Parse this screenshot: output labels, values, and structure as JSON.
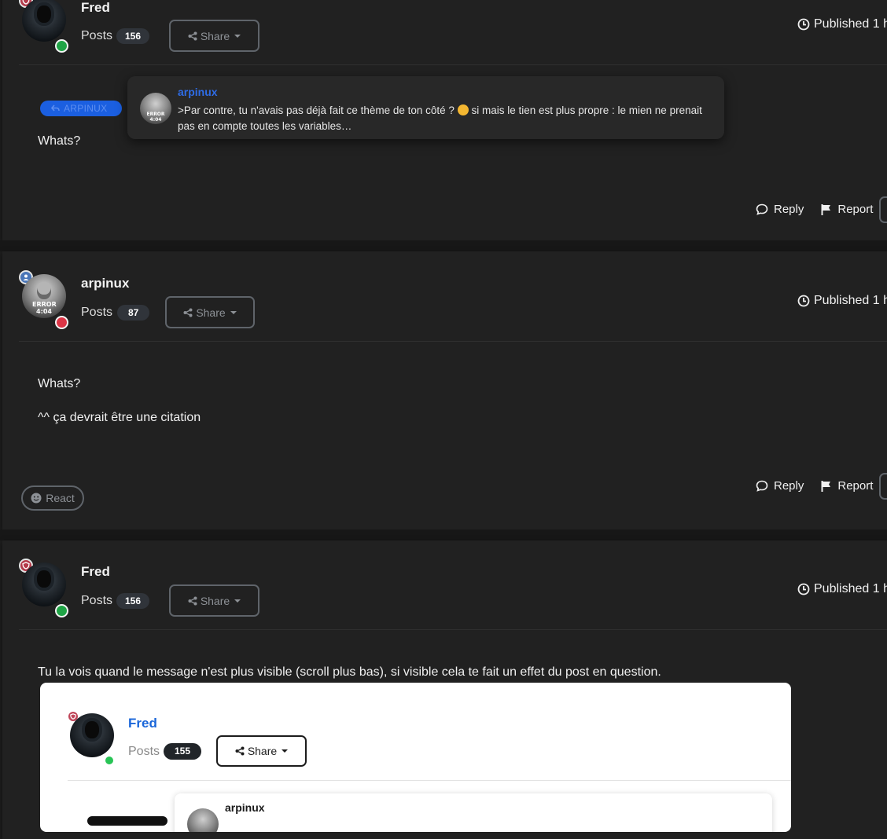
{
  "posts": [
    {
      "author": "Fred",
      "posts_label": "Posts",
      "post_count": "156",
      "share_label": "Share",
      "published": "Published 1 h",
      "quote_tag": "ARPINUX",
      "body_lines": [
        "Whats?"
      ],
      "reply_label": "Reply",
      "report_label": "Report"
    },
    {
      "author": "arpinux",
      "posts_label": "Posts",
      "post_count": "87",
      "share_label": "Share",
      "published": "Published 1 h",
      "avatar_text": "ERROR 4:04",
      "body_lines": [
        "Whats?",
        "^^ ça devrait être une citation"
      ],
      "react_label": "React",
      "reply_label": "Reply",
      "report_label": "Report"
    },
    {
      "author": "Fred",
      "posts_label": "Posts",
      "post_count": "156",
      "share_label": "Share",
      "published": "Published 1 h",
      "body_lines": [
        "Tu la vois quand le message n'est plus visible (scroll plus bas), si visible cela te fait un effet du post en question."
      ]
    }
  ],
  "quote_popup": {
    "author": "arpinux",
    "text_before_emoji": ">Par contre, tu n'avais pas déjà fait ce thème de ton côté ?",
    "text_after_emoji": "si mais le tien est plus propre : le mien ne prenait pas en compte toutes les variables…",
    "avatar_text": "ERROR 4:04"
  },
  "embedded_preview": {
    "author": "Fred",
    "posts_label": "Posts",
    "post_count": "155",
    "share_label": "Share",
    "quote_author": "arpinux"
  },
  "colors": {
    "background": "#1e1e1e",
    "card": "#212121",
    "link_blue": "#2e6ce6",
    "online": "#20a446",
    "offline": "#dc3546"
  }
}
